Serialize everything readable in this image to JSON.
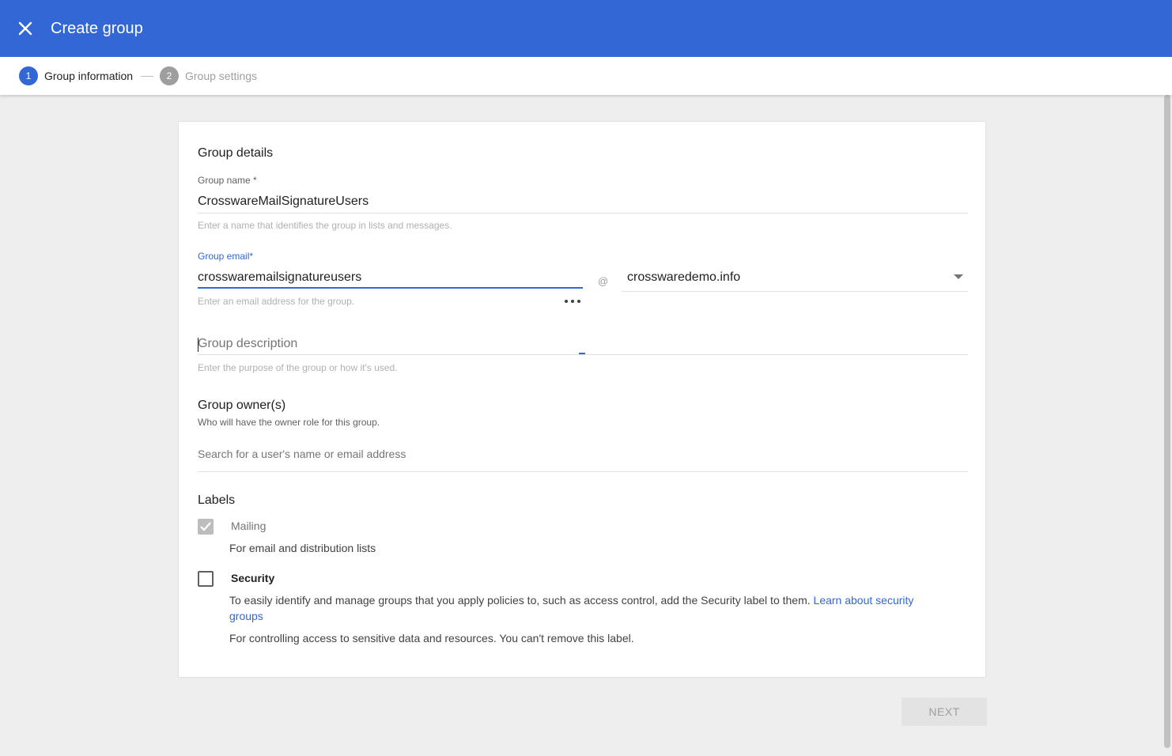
{
  "header": {
    "title": "Create group",
    "close_icon": "close-icon"
  },
  "stepper": {
    "steps": [
      {
        "number": "1",
        "label": "Group information",
        "active": true
      },
      {
        "number": "2",
        "label": "Group settings",
        "active": false
      }
    ]
  },
  "form": {
    "section_title": "Group details",
    "group_name": {
      "label": "Group name *",
      "value": "CrosswareMailSignatureUsers",
      "hint": "Enter a name that identifies the group in lists and messages."
    },
    "group_email": {
      "label": "Group email*",
      "value": "crosswaremailsignatureusers",
      "hint": "Enter an email address for the group.",
      "at": "@",
      "domain": "crosswaredemo.info"
    },
    "group_description": {
      "placeholder": "Group description",
      "hint": "Enter the purpose of the group or how it's used."
    },
    "owners": {
      "title": "Group owner(s)",
      "subtitle": "Who will have the owner role for this group.",
      "search_placeholder": "Search for a user's name or email address"
    },
    "labels": {
      "title": "Labels",
      "mailing": {
        "label": "Mailing",
        "description": "For email and distribution lists",
        "checked": true,
        "disabled": true
      },
      "security": {
        "label": "Security",
        "description": "To easily identify and manage groups that you apply policies to, such as access control, add the Security label to them.",
        "link": "Learn about security groups",
        "note": "For controlling access to sensitive data and resources. You can't remove this label.",
        "checked": false
      }
    }
  },
  "actions": {
    "next_label": "NEXT"
  },
  "colors": {
    "brand": "#3367d6",
    "link": "#3367d6"
  }
}
